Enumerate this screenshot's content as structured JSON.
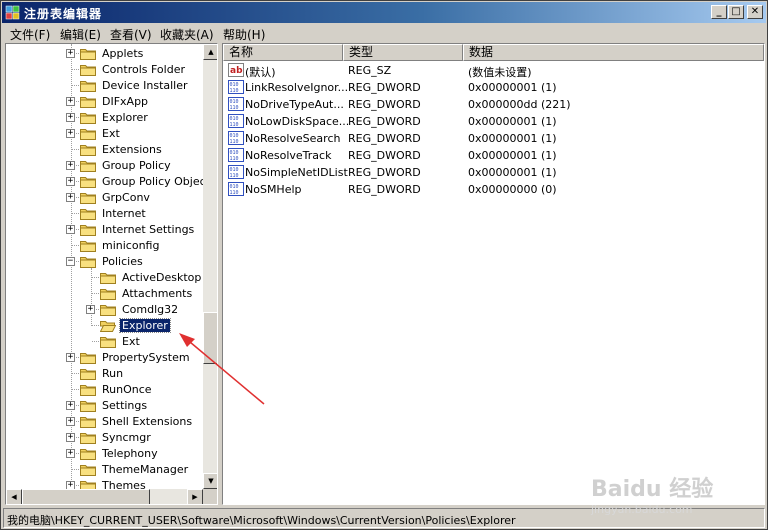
{
  "window": {
    "title": "注册表编辑器"
  },
  "menu": [
    "文件(F)",
    "编辑(E)",
    "查看(V)",
    "收藏夹(A)",
    "帮助(H)"
  ],
  "tree": [
    {
      "label": "Applets",
      "level": 0,
      "exp": "+"
    },
    {
      "label": "Controls Folder",
      "level": 0,
      "exp": ""
    },
    {
      "label": "Device Installer",
      "level": 0,
      "exp": ""
    },
    {
      "label": "DIFxApp",
      "level": 0,
      "exp": "+"
    },
    {
      "label": "Explorer",
      "level": 0,
      "exp": "+"
    },
    {
      "label": "Ext",
      "level": 0,
      "exp": "+"
    },
    {
      "label": "Extensions",
      "level": 0,
      "exp": ""
    },
    {
      "label": "Group Policy",
      "level": 0,
      "exp": "+"
    },
    {
      "label": "Group Policy Objects",
      "level": 0,
      "exp": "+"
    },
    {
      "label": "GrpConv",
      "level": 0,
      "exp": "+"
    },
    {
      "label": "Internet",
      "level": 0,
      "exp": ""
    },
    {
      "label": "Internet Settings",
      "level": 0,
      "exp": "+"
    },
    {
      "label": "miniconfig",
      "level": 0,
      "exp": ""
    },
    {
      "label": "Policies",
      "level": 0,
      "exp": "-"
    },
    {
      "label": "ActiveDesktop",
      "level": 1,
      "exp": ""
    },
    {
      "label": "Attachments",
      "level": 1,
      "exp": ""
    },
    {
      "label": "Comdlg32",
      "level": 1,
      "exp": "+"
    },
    {
      "label": "Explorer",
      "level": 1,
      "exp": "",
      "selected": true
    },
    {
      "label": "Ext",
      "level": 1,
      "exp": ""
    },
    {
      "label": "PropertySystem",
      "level": 0,
      "exp": "+"
    },
    {
      "label": "Run",
      "level": 0,
      "exp": ""
    },
    {
      "label": "RunOnce",
      "level": 0,
      "exp": ""
    },
    {
      "label": "Settings",
      "level": 0,
      "exp": "+"
    },
    {
      "label": "Shell Extensions",
      "level": 0,
      "exp": "+"
    },
    {
      "label": "Syncmgr",
      "level": 0,
      "exp": "+"
    },
    {
      "label": "Telephony",
      "level": 0,
      "exp": "+"
    },
    {
      "label": "ThemeManager",
      "level": 0,
      "exp": ""
    },
    {
      "label": "Themes",
      "level": 0,
      "exp": "+"
    }
  ],
  "list": {
    "columns": [
      "名称",
      "类型",
      "数据"
    ],
    "rows": [
      {
        "name": "(默认)",
        "type": "REG_SZ",
        "data": "(数值未设置)",
        "icon": "string-value-icon"
      },
      {
        "name": "LinkResolveIgnor...",
        "type": "REG_DWORD",
        "data": "0x00000001 (1)",
        "icon": "dword-value-icon"
      },
      {
        "name": "NoDriveTypeAut...",
        "type": "REG_DWORD",
        "data": "0x000000dd (221)",
        "icon": "dword-value-icon"
      },
      {
        "name": "NoLowDiskSpace...",
        "type": "REG_DWORD",
        "data": "0x00000001 (1)",
        "icon": "dword-value-icon"
      },
      {
        "name": "NoResolveSearch",
        "type": "REG_DWORD",
        "data": "0x00000001 (1)",
        "icon": "dword-value-icon"
      },
      {
        "name": "NoResolveTrack",
        "type": "REG_DWORD",
        "data": "0x00000001 (1)",
        "icon": "dword-value-icon"
      },
      {
        "name": "NoSimpleNetIDList",
        "type": "REG_DWORD",
        "data": "0x00000001 (1)",
        "icon": "dword-value-icon"
      },
      {
        "name": "NoSMHelp",
        "type": "REG_DWORD",
        "data": "0x00000000 (0)",
        "icon": "dword-value-icon"
      }
    ]
  },
  "status": "我的电脑\\HKEY_CURRENT_USER\\Software\\Microsoft\\Windows\\CurrentVersion\\Policies\\Explorer",
  "watermark": {
    "brand": "Baidu 经验",
    "url": "jingyan.baidu.com"
  }
}
